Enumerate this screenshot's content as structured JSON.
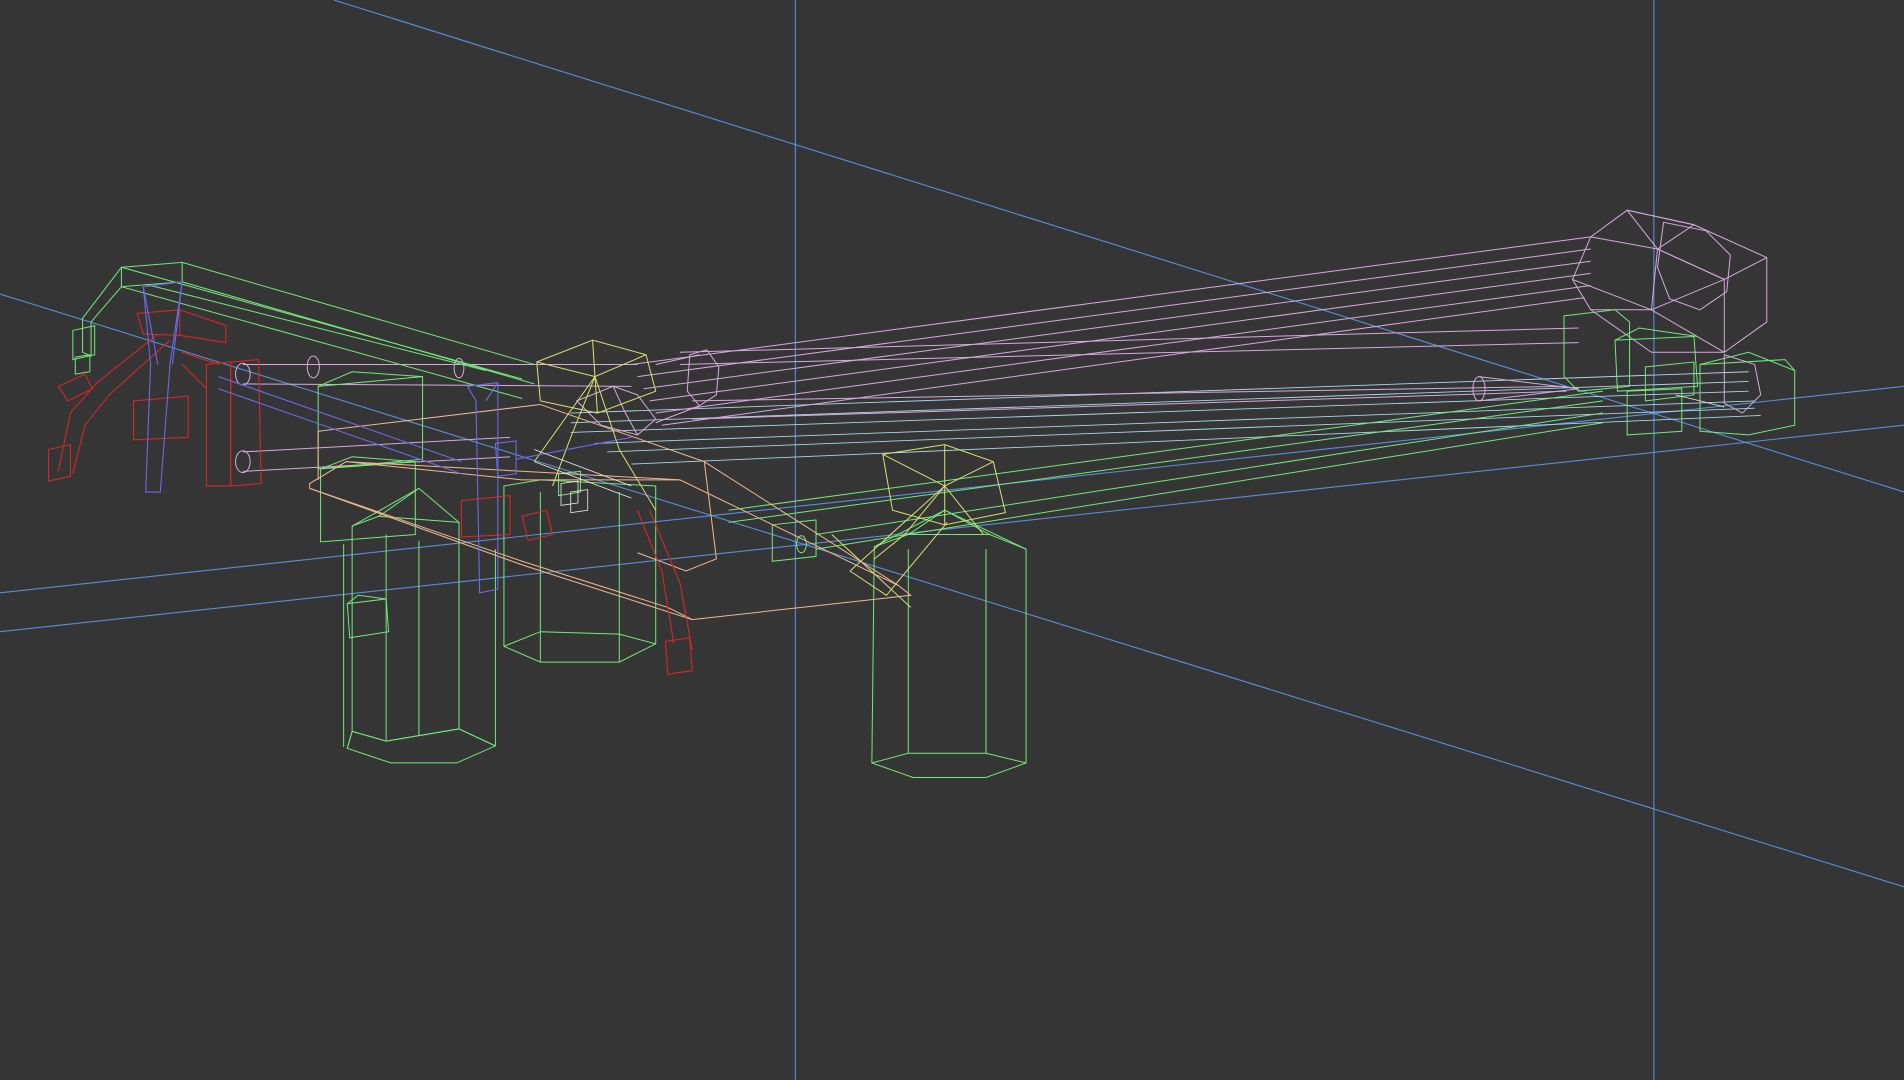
{
  "viewport": {
    "mode": "wireframe",
    "background_color": "#353535",
    "grid_color": "#5a8ed8"
  },
  "colors": {
    "robot_arm": "#d8a8e0",
    "base_frame": "#74e87a",
    "lights_and_tripods": "#d8e070",
    "gripper_red": "#d02828",
    "gripper_blue": "#6a6ae8",
    "cables": "#a6d8e8"
  },
  "icons": [
    "wireframe-model"
  ]
}
